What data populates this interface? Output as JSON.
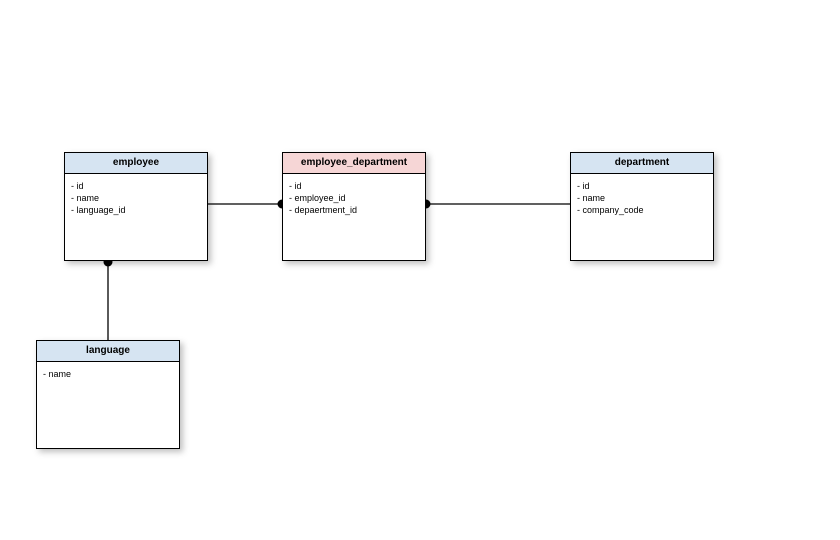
{
  "diagram": {
    "entities": {
      "employee": {
        "title": "employee",
        "fields": "- id\n- name\n- language_id",
        "header_color": "blue"
      },
      "employee_department": {
        "title": "employee_department",
        "fields": "- id\n- employee_id\n- depaertment_id",
        "header_color": "pink"
      },
      "department": {
        "title": "department",
        "fields": "- id\n- name\n- company_code",
        "header_color": "blue"
      },
      "language": {
        "title": "language",
        "fields": "- name",
        "header_color": "blue"
      }
    },
    "relationships": [
      {
        "from": "employee",
        "to": "employee_department",
        "many_end": "employee_department"
      },
      {
        "from": "department",
        "to": "employee_department",
        "many_end": "employee_department"
      },
      {
        "from": "language",
        "to": "employee",
        "many_end": "employee"
      }
    ]
  }
}
